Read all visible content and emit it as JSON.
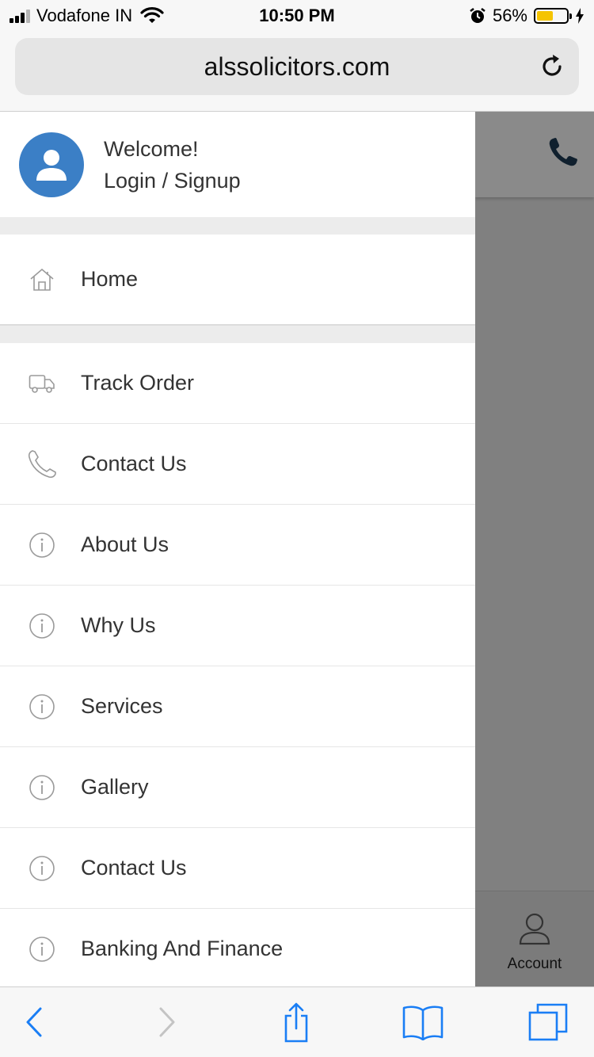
{
  "status_bar": {
    "carrier": "Vodafone IN",
    "time": "10:50 PM",
    "battery_percent": "56%",
    "battery_level": 0.56,
    "battery_color": "#f5c400"
  },
  "browser": {
    "url": "alssolicitors.com",
    "reload_icon": "reload-icon"
  },
  "drawer": {
    "welcome": "Welcome!",
    "login_signup": "Login / Signup",
    "avatar_color": "#3b7fc6",
    "home": {
      "label": "Home",
      "icon": "home-icon"
    },
    "items": [
      {
        "label": "Track Order",
        "icon": "truck-icon"
      },
      {
        "label": "Contact Us",
        "icon": "phone-icon"
      },
      {
        "label": "About Us",
        "icon": "info-icon"
      },
      {
        "label": "Why Us",
        "icon": "info-icon"
      },
      {
        "label": "Services",
        "icon": "info-icon"
      },
      {
        "label": "Gallery",
        "icon": "info-icon"
      },
      {
        "label": "Contact Us",
        "icon": "info-icon"
      },
      {
        "label": "Banking And Finance",
        "icon": "info-icon"
      }
    ]
  },
  "background_page": {
    "account_label": "Account",
    "phone_icon": "phone-icon"
  },
  "toolbar": {
    "back_icon": "back-chevron-icon",
    "forward_icon": "forward-chevron-icon",
    "share_icon": "share-icon",
    "bookmarks_icon": "bookmarks-icon",
    "tabs_icon": "tabs-icon",
    "accent_color": "#1a7ef5"
  }
}
